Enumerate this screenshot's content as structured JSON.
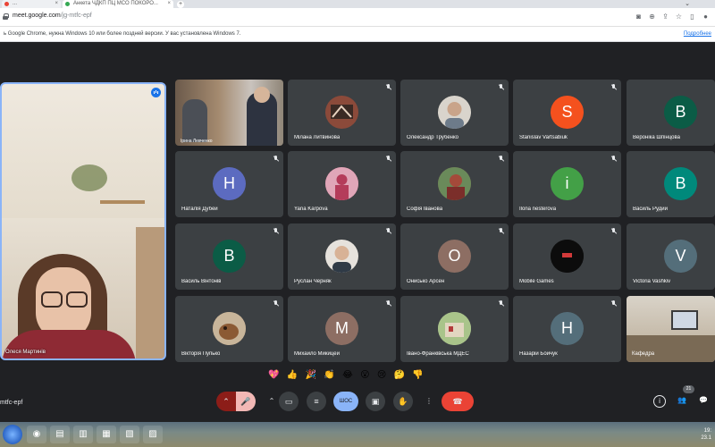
{
  "browser": {
    "tabs": [
      {
        "label": "..."
      },
      {
        "label": "Анкета ЧДКП ПЦ МСО ПОКОРО..."
      }
    ],
    "url_host": "meet.google.com",
    "url_path": "/jg-mtfc-epf",
    "infobar_message": "ь Google Chrome, нужна Windows 10 или более поздней версии. У вас установлена Windows 7.",
    "infobar_link": "Подробнее"
  },
  "self_view": {
    "name": "Олеся Мартинів"
  },
  "participants": [
    {
      "name": "Ірина Левченко",
      "type": "video"
    },
    {
      "name": "Мілана Литвинова",
      "type": "photo",
      "color": "#8b4a3a"
    },
    {
      "name": "Олександр Трубенко",
      "type": "photo",
      "color": "#c9c2b8"
    },
    {
      "name": "Stanislav Vartsabiuk",
      "type": "letter",
      "initial": "S",
      "color": "#f4511e"
    },
    {
      "name": "Вероніка Шпінцова",
      "type": "letter",
      "initial": "В",
      "color": "#0b5c46"
    },
    {
      "name": "Наталія Дубей",
      "type": "letter",
      "initial": "Н",
      "color": "#5c6bc0"
    },
    {
      "name": "Yana Karpova",
      "type": "photo",
      "color": "#c85b7a"
    },
    {
      "name": "Софія Іванова",
      "type": "photo",
      "color": "#8c5a44"
    },
    {
      "name": "Ilona nesterova",
      "type": "letter",
      "initial": "i",
      "color": "#43a047"
    },
    {
      "name": "Василь Рудий",
      "type": "letter",
      "initial": "В",
      "color": "#00897b"
    },
    {
      "name": "Василь Вінтонів",
      "type": "letter",
      "initial": "В",
      "color": "#0b5c46"
    },
    {
      "name": "Руслан Черняк",
      "type": "photo",
      "color": "#e6e2dc"
    },
    {
      "name": "Онисько Арсен",
      "type": "letter",
      "initial": "О",
      "color": "#8d6e63"
    },
    {
      "name": "Mobile Games",
      "type": "photo",
      "color": "#111111"
    },
    {
      "name": "Victoria Vashkiv",
      "type": "letter",
      "initial": "V",
      "color": "#546e7a"
    },
    {
      "name": "Вікторія Пупько",
      "type": "photo",
      "color": "#9c7b5a"
    },
    {
      "name": "Михайло Микицей",
      "type": "letter",
      "initial": "М",
      "color": "#8d6e63"
    },
    {
      "name": "Івано-Франківська МДЕС",
      "type": "photo",
      "color": "#b9c7a0"
    },
    {
      "name": "Назарій Бойчук",
      "type": "letter",
      "initial": "Н",
      "color": "#546e7a"
    },
    {
      "name": "Кафедра",
      "type": "video"
    }
  ],
  "reactions": [
    "💖",
    "👍",
    "🎉",
    "👏",
    "😂",
    "😮",
    "😢",
    "🤔",
    "👎"
  ],
  "controls": {
    "meeting_code": "mtfc-epf",
    "present_label": "ШОС",
    "people_count": "21"
  },
  "taskbar": {
    "time": "19:",
    "date": "23.1"
  }
}
